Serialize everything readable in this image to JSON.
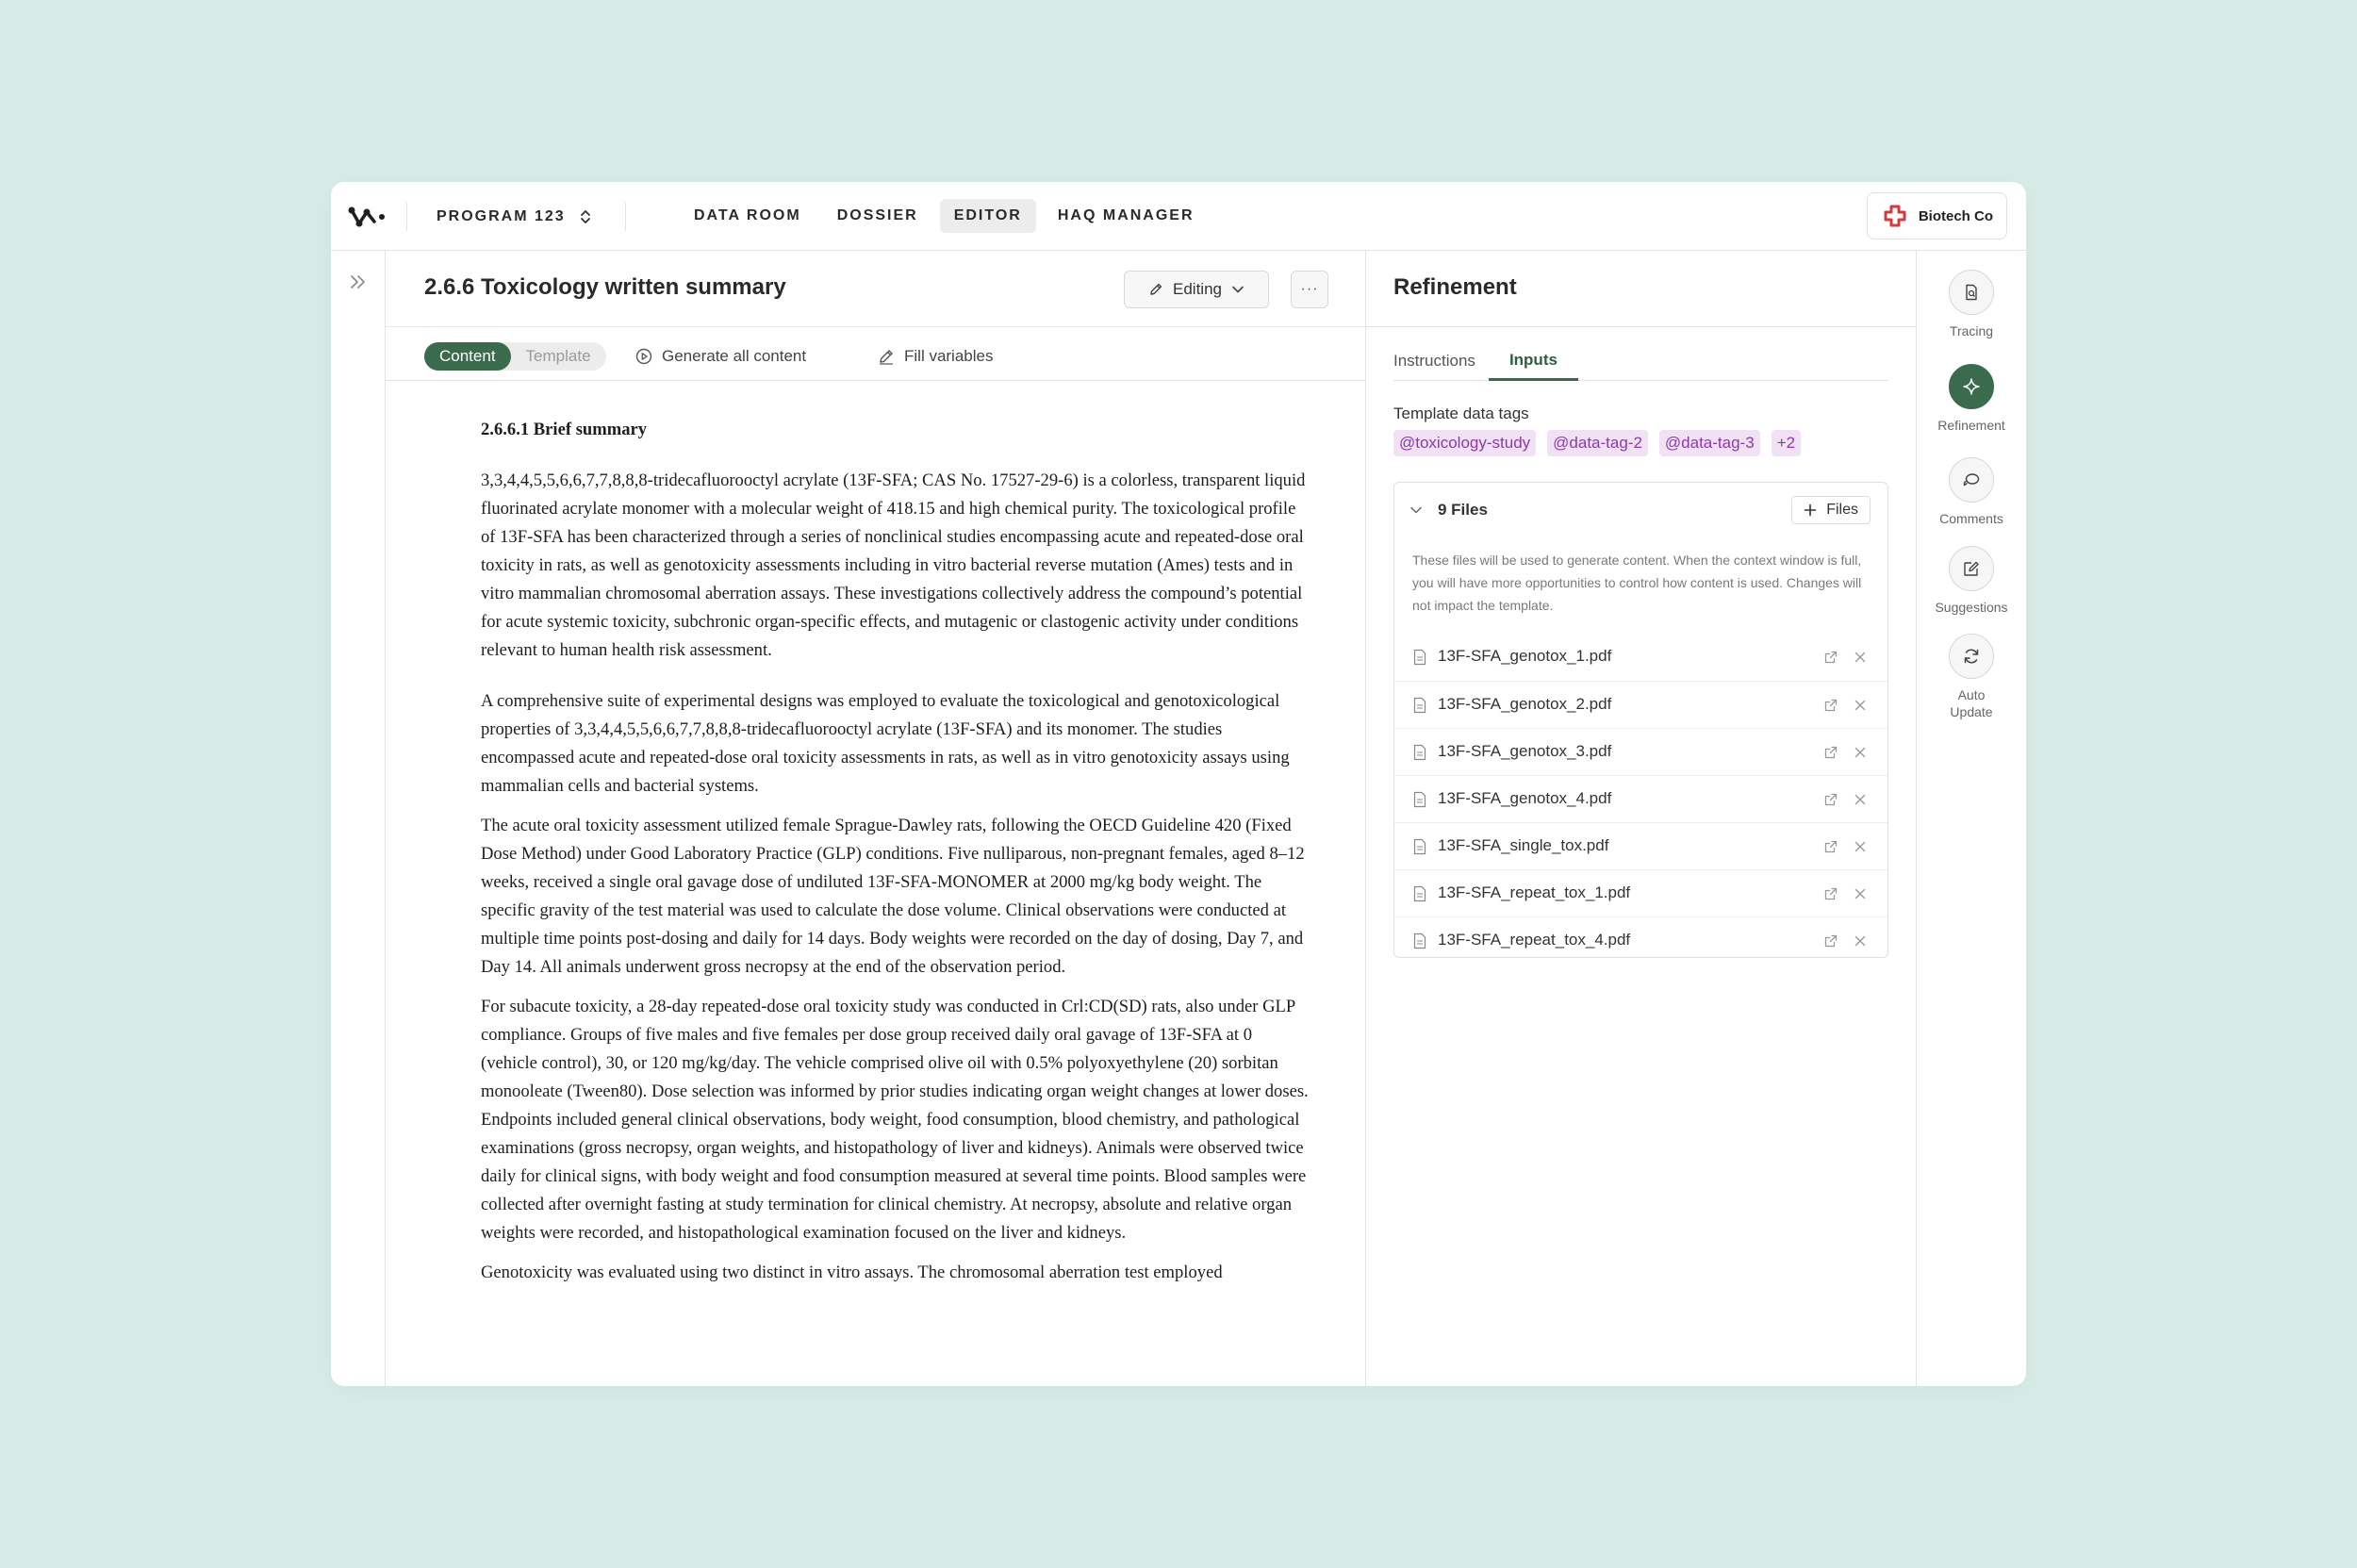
{
  "topbar": {
    "program": "PROGRAM 123",
    "nav": [
      "DATA ROOM",
      "DOSSIER",
      "EDITOR",
      "HAQ MANAGER"
    ],
    "active_nav": "EDITOR",
    "org": "Biotech Co"
  },
  "document": {
    "title": "2.6.6 Toxicology written summary",
    "mode_label": "Editing",
    "more_label": "···",
    "tabs": {
      "content": "Content",
      "template": "Template"
    },
    "generate_label": "Generate all content",
    "fill_label": "Fill variables",
    "section_heading": "2.6.6.1 Brief summary",
    "paragraphs": [
      "3,3,4,4,5,5,6,6,7,7,8,8,8-tridecafluorooctyl acrylate (13F-SFA; CAS No. 17527-29-6) is a colorless, transparent liquid fluorinated acrylate monomer with a molecular weight of 418.15 and high chemical purity. The toxicological profile of 13F-SFA has been characterized through a series of nonclinical studies encompassing acute and repeated-dose oral toxicity in rats, as well as genotoxicity assessments including in vitro bacterial reverse mutation (Ames) tests and in vitro mammalian chromosomal aberration assays. These investigations collectively address the compound’s potential for acute systemic toxicity, subchronic organ-specific effects, and mutagenic or clastogenic activity under conditions relevant to human health risk assessment.",
      "A comprehensive suite of experimental designs was employed to evaluate the toxicological and genotoxicological properties of 3,3,4,4,5,5,6,6,7,7,8,8,8-tridecafluorooctyl acrylate (13F-SFA) and its monomer. The studies encompassed acute and repeated-dose oral toxicity assessments in rats, as well as in vitro genotoxicity assays using mammalian cells and bacterial systems.",
      "The acute oral toxicity assessment utilized female Sprague-Dawley rats, following the OECD Guideline 420 (Fixed Dose Method) under Good Laboratory Practice (GLP) conditions. Five nulliparous, non-pregnant females, aged 8–12 weeks, received a single oral gavage dose of undiluted 13F-SFA-MONOMER at 2000 mg/kg body weight. The specific gravity of the test material was used to calculate the dose volume. Clinical observations were conducted at multiple time points post-dosing and daily for 14 days. Body weights were recorded on the day of dosing, Day 7, and Day 14. All animals underwent gross necropsy at the end of the observation period.",
      "For subacute toxicity, a 28-day repeated-dose oral toxicity study was conducted in Crl:CD(SD) rats, also under GLP compliance. Groups of five males and five females per dose group received daily oral gavage of 13F-SFA at 0 (vehicle control), 30, or 120 mg/kg/day. The vehicle comprised olive oil with 0.5% polyoxyethylene (20) sorbitan monooleate (Tween80). Dose selection was informed by prior studies indicating organ weight changes at lower doses. Endpoints included general clinical observations, body weight, food consumption, blood chemistry, and pathological examinations (gross necropsy, organ weights, and histopathology of liver and kidneys). Animals were observed twice daily for clinical signs, with body weight and food consumption measured at several time points. Blood samples were collected after overnight fasting at study termination for clinical chemistry. At necropsy, absolute and relative organ weights were recorded, and histopathological examination focused on the liver and kidneys.",
      "Genotoxicity was evaluated using two distinct in vitro assays. The chromosomal aberration test employed"
    ]
  },
  "refinement": {
    "title": "Refinement",
    "tabs": [
      "Instructions",
      "Inputs"
    ],
    "active_tab": "Inputs",
    "tags_label": "Template data tags",
    "tags": [
      "@toxicology-study",
      "@data-tag-2",
      "@data-tag-3",
      "+2"
    ],
    "files_count": "9 Files",
    "add_files_label": "Files",
    "files_note": "These files will be used to generate content. When the context window is full, you will have more opportunities to control how content is used. Changes will not impact the template.",
    "files": [
      "13F-SFA_genotox_1.pdf",
      "13F-SFA_genotox_2.pdf",
      "13F-SFA_genotox_3.pdf",
      "13F-SFA_genotox_4.pdf",
      "13F-SFA_single_tox.pdf",
      "13F-SFA_repeat_tox_1.pdf",
      "13F-SFA_repeat_tox_4.pdf"
    ]
  },
  "rail": [
    {
      "label": "Tracing",
      "icon": "tracing-icon"
    },
    {
      "label": "Refinement",
      "icon": "sparkle-icon"
    },
    {
      "label": "Comments",
      "icon": "comments-icon"
    },
    {
      "label": "Suggestions",
      "icon": "suggestions-icon"
    },
    {
      "label": "Auto\nUpdate",
      "icon": "refresh-icon"
    }
  ],
  "colors": {
    "background": "#d8ebe6",
    "accent_green": "#3a6b4d",
    "tag_bg": "#f0e1f5",
    "tag_text": "#8c3aa8"
  }
}
